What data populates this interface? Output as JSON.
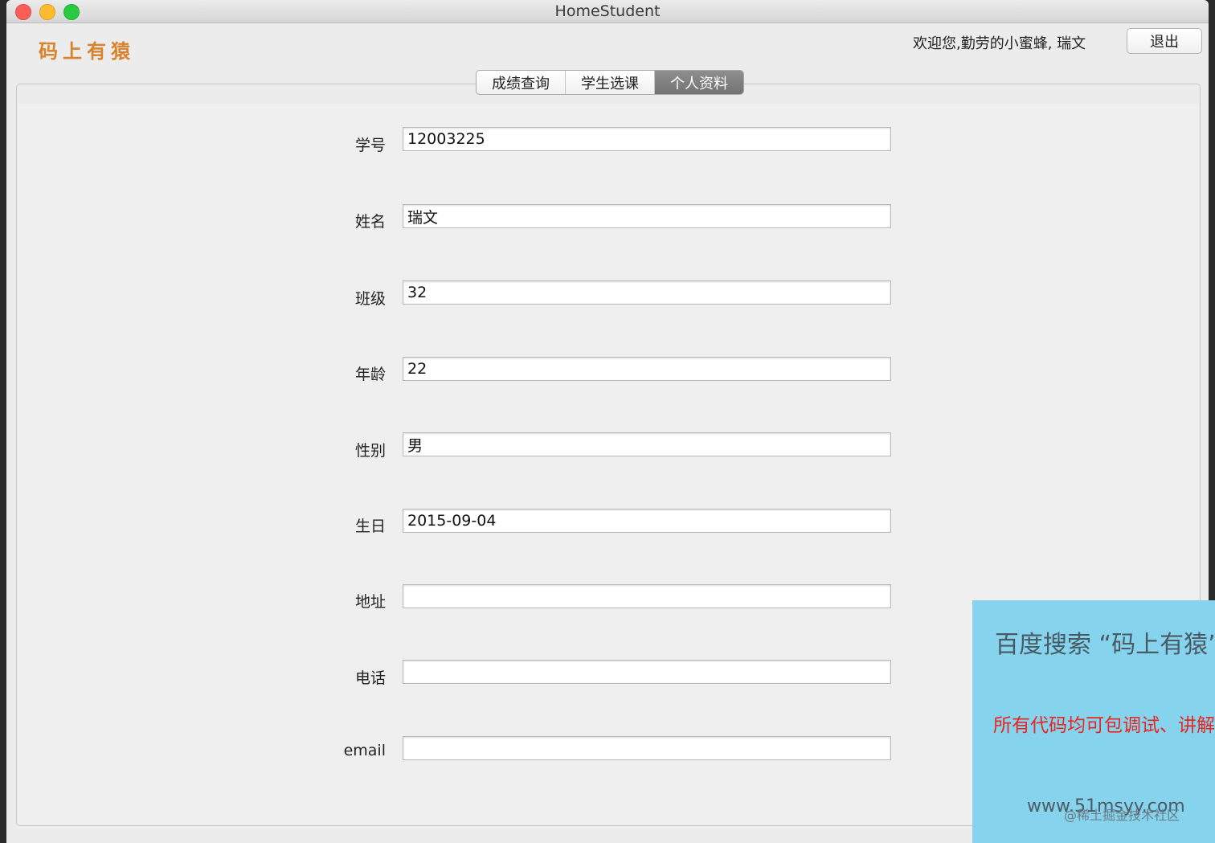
{
  "window": {
    "title": "HomeStudent"
  },
  "header": {
    "logo_text": "码上有猿",
    "welcome_text": "欢迎您,勤劳的小蜜蜂,   瑞文",
    "logout_label": "退出"
  },
  "tabs": [
    {
      "label": "成绩查询",
      "active": false
    },
    {
      "label": "学生选课",
      "active": false
    },
    {
      "label": "个人资料",
      "active": true
    }
  ],
  "form": {
    "fields": [
      {
        "label": "学号",
        "value": "12003225"
      },
      {
        "label": "姓名",
        "value": "瑞文"
      },
      {
        "label": "班级",
        "value": "32"
      },
      {
        "label": "年龄",
        "value": "22"
      },
      {
        "label": "性别",
        "value": "男"
      },
      {
        "label": "生日",
        "value": "2015-09-04"
      },
      {
        "label": "地址",
        "value": ""
      },
      {
        "label": "电话",
        "value": ""
      },
      {
        "label": "email",
        "value": ""
      }
    ]
  },
  "ad": {
    "title": "百度搜索 “码上有猿”",
    "subtitle": "所有代码均可包调试、讲解",
    "url": "www.51msyy.com",
    "watermark": "@稀土掘金技术社区"
  },
  "colors": {
    "logo": "#d9822b",
    "ad_background": "#86d3ee",
    "ad_subtitle": "#e8261f"
  }
}
